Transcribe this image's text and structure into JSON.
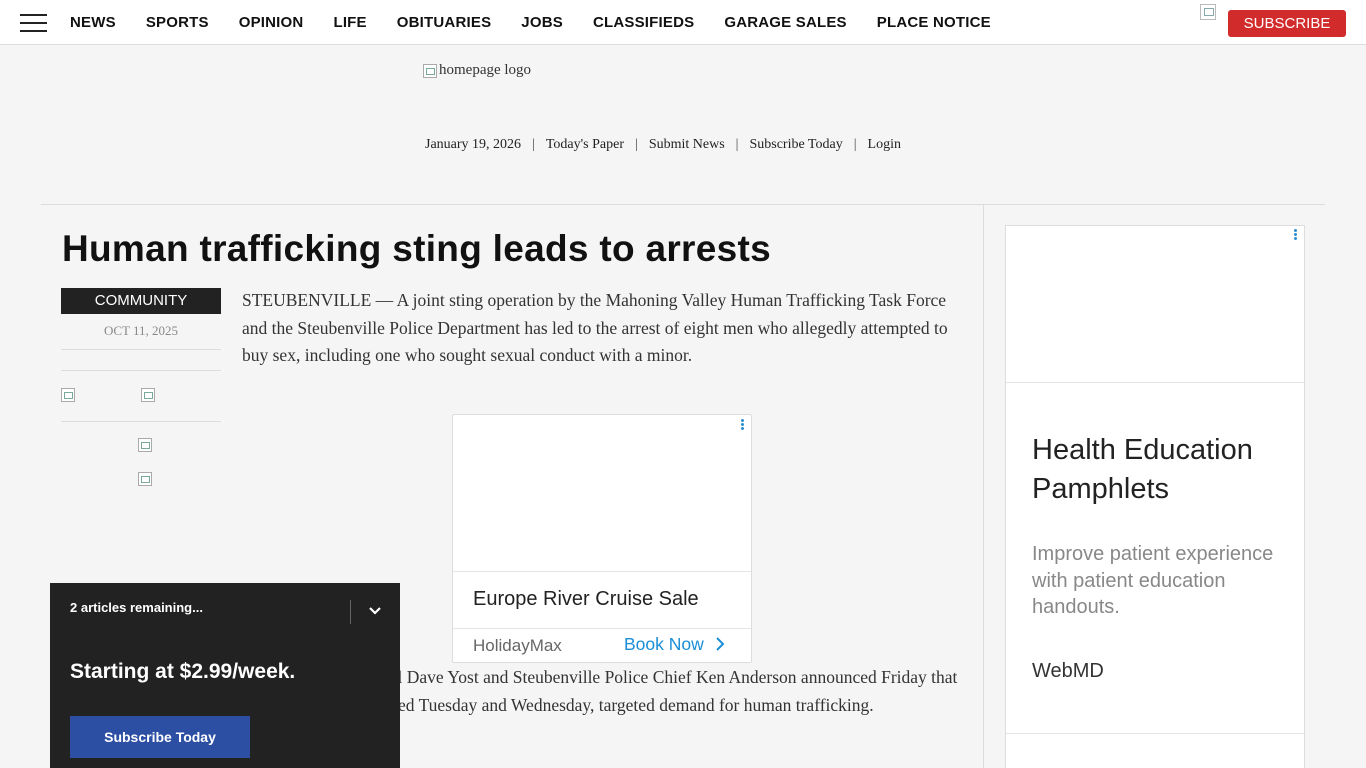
{
  "nav": {
    "items": [
      "NEWS",
      "SPORTS",
      "OPINION",
      "LIFE",
      "OBITUARIES",
      "JOBS",
      "CLASSIFIEDS",
      "GARAGE SALES",
      "PLACE NOTICE"
    ],
    "subscribe_label": "SUBSCRIBE"
  },
  "masthead": {
    "logo_alt": "homepage logo",
    "date": "January 19, 2026",
    "links": [
      "Today's Paper",
      "Submit News",
      "Subscribe Today",
      "Login"
    ],
    "separator": "|"
  },
  "article": {
    "headline": "Human trafficking sting leads to arrests",
    "category": "COMMUNITY",
    "date": "OCT 11, 2025",
    "paragraph1": "STEUBENVILLE — A joint sting operation by the Mahoning Valley Human Trafficking Task Force and the Steubenville Police Department has led to the arrest of eight men who allegedly attempted to buy sex, including one who sought sexual conduct with a minor.",
    "paragraph2": "Ohio Attorney General Dave Yost and Steubenville Police Chief Ken Anderson announced Friday that the operation, conducted Tuesday and Wednesday, targeted demand for human trafficking."
  },
  "inline_ad": {
    "title": "Europe River Cruise Sale",
    "source": "HolidayMax",
    "cta": "Book Now",
    "cta_icon": "chevron-right-icon"
  },
  "rail_ad": {
    "title": "Health Education Pamphlets",
    "description": "Improve patient experience with patient education handouts.",
    "source": "WebMD"
  },
  "paywall": {
    "remaining": "2 articles remaining...",
    "price": "Starting at $2.99/week.",
    "button": "Subscribe Today"
  },
  "colors": {
    "subscribe_red": "#d12b2b",
    "paywall_bg": "#222222",
    "paywall_button": "#2d4fa3",
    "ad_link_blue": "#1a8ed6"
  }
}
